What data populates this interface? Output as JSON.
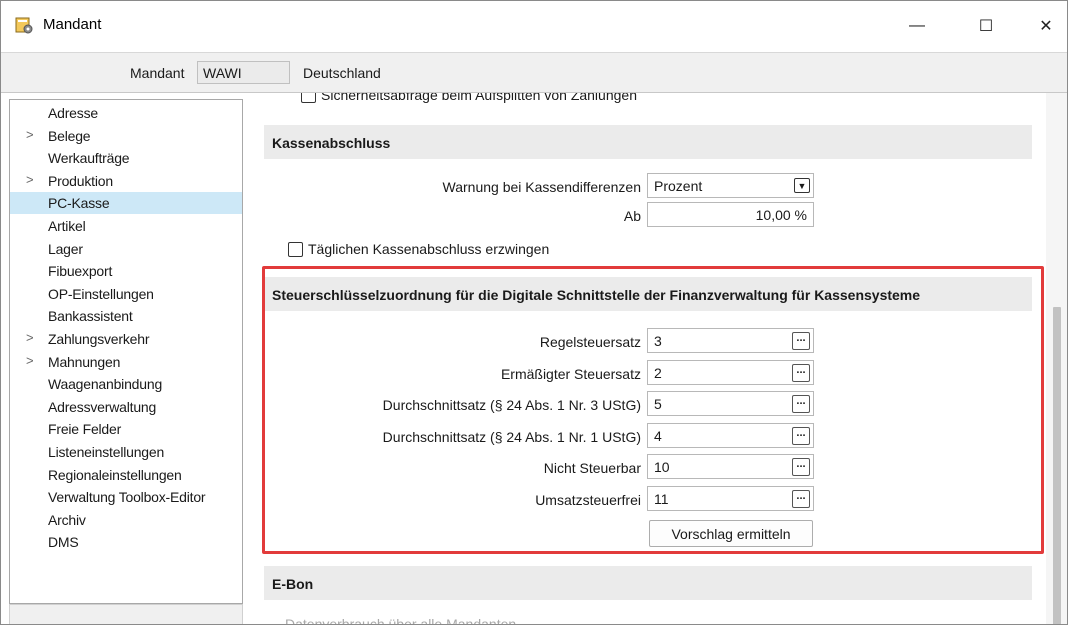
{
  "window": {
    "title": "Mandant",
    "minimize_glyph": "—",
    "maximize_glyph": "☐",
    "close_glyph": "✕"
  },
  "header": {
    "mandant_label": "Mandant",
    "mandant_value": "WAWI",
    "country": "Deutschland"
  },
  "sidebar": {
    "items": [
      {
        "label": "Adresse",
        "expandable": false
      },
      {
        "label": "Belege",
        "expandable": true
      },
      {
        "label": "Werkaufträge",
        "expandable": false
      },
      {
        "label": "Produktion",
        "expandable": true
      },
      {
        "label": "PC-Kasse",
        "expandable": false,
        "selected": true
      },
      {
        "label": "Artikel",
        "expandable": false
      },
      {
        "label": "Lager",
        "expandable": false
      },
      {
        "label": "Fibuexport",
        "expandable": false
      },
      {
        "label": "OP-Einstellungen",
        "expandable": false
      },
      {
        "label": "Bankassistent",
        "expandable": false
      },
      {
        "label": "Zahlungsverkehr",
        "expandable": true
      },
      {
        "label": "Mahnungen",
        "expandable": true
      },
      {
        "label": "Waagenanbindung",
        "expandable": false
      },
      {
        "label": "Adressverwaltung",
        "expandable": false
      },
      {
        "label": "Freie Felder",
        "expandable": false
      },
      {
        "label": "Listeneinstellungen",
        "expandable": false
      },
      {
        "label": "Regionaleinstellungen",
        "expandable": false
      },
      {
        "label": "Verwaltung Toolbox-Editor",
        "expandable": false
      },
      {
        "label": "Archiv",
        "expandable": false
      },
      {
        "label": "DMS",
        "expandable": false
      }
    ],
    "chevron_glyph": ">"
  },
  "content": {
    "top_checkbox_label": "Sicherheitsabfrage beim Aufsplitten von Zahlungen",
    "kassenabschluss": {
      "title": "Kassenabschluss",
      "warnung_label": "Warnung bei Kassendifferenzen",
      "warnung_value": "Prozent",
      "ab_label": "Ab",
      "ab_value": "10,00 %",
      "erzwingen_label": "Täglichen Kassenabschluss erzwingen"
    },
    "steuer": {
      "title": "Steuerschlüsselzuordnung für die Digitale Schnittstelle der Finanzverwaltung für Kassensysteme",
      "rows": [
        {
          "label": "Regelsteuersatz",
          "value": "3"
        },
        {
          "label": "Ermäßigter Steuersatz",
          "value": "2"
        },
        {
          "label": "Durchschnittsatz (§ 24 Abs. 1 Nr. 3 UStG)",
          "value": "5"
        },
        {
          "label": "Durchschnittsatz (§ 24 Abs. 1 Nr. 1 UStG)",
          "value": "4"
        },
        {
          "label": "Nicht Steuerbar",
          "value": "10"
        },
        {
          "label": "Umsatzsteuerfrei",
          "value": "11"
        }
      ],
      "dots_label": "...",
      "vorschlag_button": "Vorschlag ermitteln"
    },
    "ebon": {
      "title": "E-Bon",
      "datenverbrauch_label": "Datenverbrauch über alle Mandanten"
    }
  },
  "colors": {
    "highlight_border": "#e23b3b",
    "selected_item_bg": "#cde8f7",
    "section_header_bg": "#ebebeb"
  }
}
